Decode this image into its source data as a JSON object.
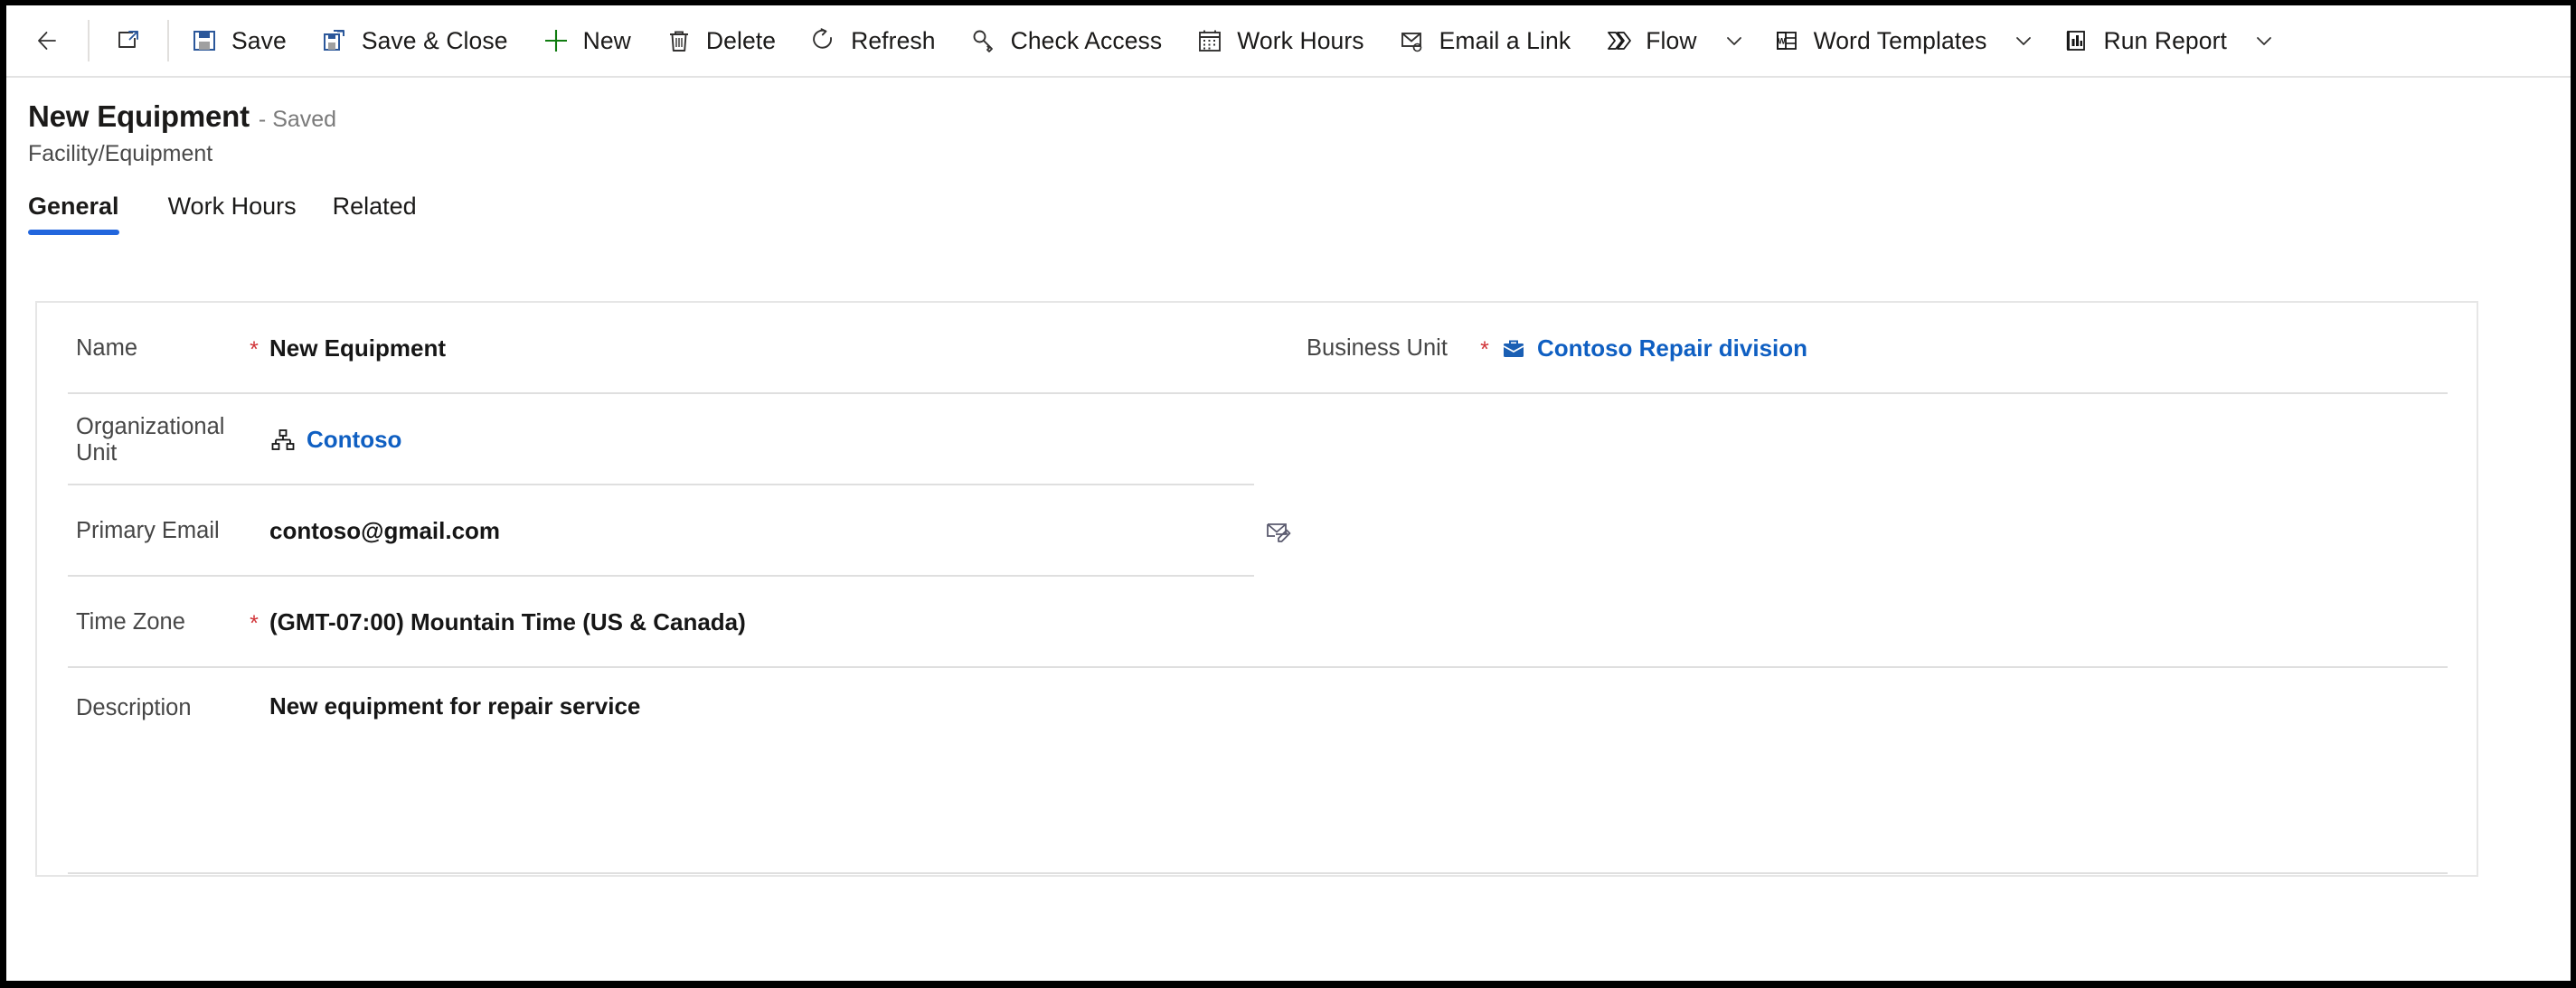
{
  "command_bar": {
    "items": [
      {
        "name": "back",
        "icon": "arrow-left-icon",
        "label": ""
      },
      {
        "name": "popout",
        "icon": "open-in-new-icon",
        "label": ""
      },
      {
        "name": "save",
        "icon": "save-icon",
        "label": "Save"
      },
      {
        "name": "save-close",
        "icon": "save-close-icon",
        "label": "Save & Close"
      },
      {
        "name": "new",
        "icon": "plus-icon",
        "label": "New"
      },
      {
        "name": "delete",
        "icon": "trash-icon",
        "label": "Delete"
      },
      {
        "name": "refresh",
        "icon": "refresh-icon",
        "label": "Refresh"
      },
      {
        "name": "check-access",
        "icon": "key-icon",
        "label": "Check Access"
      },
      {
        "name": "work-hours",
        "icon": "calendar-icon",
        "label": "Work Hours"
      },
      {
        "name": "email-a-link",
        "icon": "email-link-icon",
        "label": "Email a Link"
      },
      {
        "name": "flow",
        "icon": "flow-icon",
        "label": "Flow"
      },
      {
        "name": "word-templates",
        "icon": "word-icon",
        "label": "Word Templates"
      },
      {
        "name": "run-report",
        "icon": "report-icon",
        "label": "Run Report"
      }
    ]
  },
  "record": {
    "title": "New Equipment",
    "state": "- Saved",
    "entity": "Facility/Equipment"
  },
  "tabs": [
    {
      "label": "General",
      "selected": true
    },
    {
      "label": "Work Hours",
      "selected": false
    },
    {
      "label": "Related",
      "selected": false
    }
  ],
  "form": {
    "name": {
      "label": "Name",
      "required": "*",
      "value": "New Equipment"
    },
    "business_unit": {
      "label": "Business Unit",
      "required": "*",
      "value": "Contoso Repair division",
      "icon": "briefcase-icon"
    },
    "organizational_unit": {
      "label": "Organizational Unit",
      "value": "Contoso",
      "icon": "org-hierarchy-icon"
    },
    "primary_email": {
      "label": "Primary Email",
      "value": "contoso@gmail.com",
      "action_icon": "compose-email-icon"
    },
    "time_zone": {
      "label": "Time Zone",
      "required": "*",
      "value": "(GMT-07:00) Mountain Time (US & Canada)"
    },
    "description": {
      "label": "Description",
      "value": "New equipment for repair service"
    }
  },
  "colors": {
    "accent_blue": "#2266dd",
    "link_blue": "#0f5fc2",
    "required_red": "#d13438",
    "divider_gray": "#dfdfdf",
    "text_primary": "#161616",
    "text_secondary": "#464646"
  }
}
